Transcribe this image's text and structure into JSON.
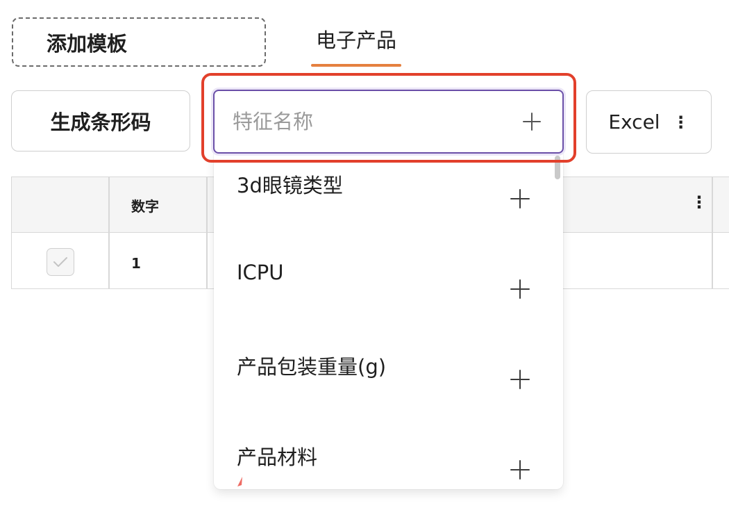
{
  "header": {
    "add_template_label": "添加模板",
    "active_tab_label": "电子产品"
  },
  "toolbar": {
    "barcode_label": "生成条形码",
    "excel_label": "Excel"
  },
  "table": {
    "columns": [
      "数字"
    ],
    "rows": [
      {
        "checked": true,
        "number": "1"
      }
    ]
  },
  "feature_search": {
    "placeholder": "特征名称",
    "value": ""
  },
  "feature_options": [
    {
      "label": "3d眼镜类型"
    },
    {
      "label": "ICPU"
    },
    {
      "label": "产品包装重量(g)"
    },
    {
      "label": "产品材料"
    }
  ],
  "colors": {
    "highlight_border": "#e2402b",
    "tab_underline": "#e5803f",
    "input_focus": "#6a4fa8"
  }
}
